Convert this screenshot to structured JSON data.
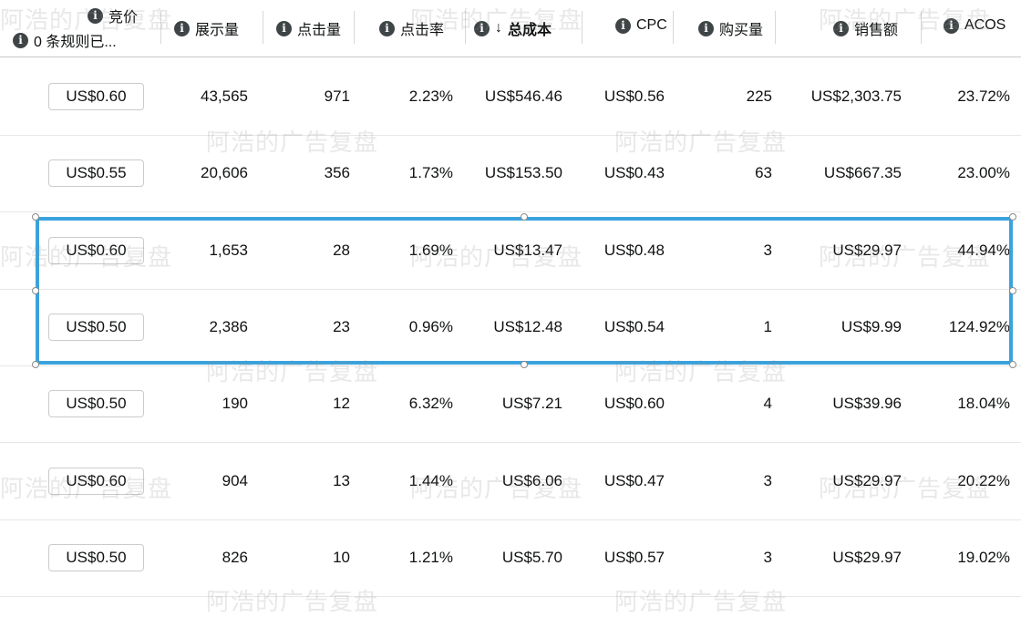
{
  "header": {
    "bid": "竞价",
    "rules": "0 条规则已...",
    "impressions": "展示量",
    "clicks": "点击量",
    "ctr": "点击率",
    "cost_arrow": "↓",
    "cost": "总成本",
    "cpc": "CPC",
    "orders": "购买量",
    "sales": "销售额",
    "acos": "ACOS"
  },
  "rows": [
    {
      "bid": "US$0.60",
      "impressions": "43,565",
      "clicks": "971",
      "ctr": "2.23%",
      "cost": "US$546.46",
      "cpc": "US$0.56",
      "orders": "225",
      "sales": "US$2,303.75",
      "acos": "23.72%"
    },
    {
      "bid": "US$0.55",
      "impressions": "20,606",
      "clicks": "356",
      "ctr": "1.73%",
      "cost": "US$153.50",
      "cpc": "US$0.43",
      "orders": "63",
      "sales": "US$667.35",
      "acos": "23.00%"
    },
    {
      "bid": "US$0.60",
      "impressions": "1,653",
      "clicks": "28",
      "ctr": "1.69%",
      "cost": "US$13.47",
      "cpc": "US$0.48",
      "orders": "3",
      "sales": "US$29.97",
      "acos": "44.94%"
    },
    {
      "bid": "US$0.50",
      "impressions": "2,386",
      "clicks": "23",
      "ctr": "0.96%",
      "cost": "US$12.48",
      "cpc": "US$0.54",
      "orders": "1",
      "sales": "US$9.99",
      "acos": "124.92%"
    },
    {
      "bid": "US$0.50",
      "impressions": "190",
      "clicks": "12",
      "ctr": "6.32%",
      "cost": "US$7.21",
      "cpc": "US$0.60",
      "orders": "4",
      "sales": "US$39.96",
      "acos": "18.04%"
    },
    {
      "bid": "US$0.60",
      "impressions": "904",
      "clicks": "13",
      "ctr": "1.44%",
      "cost": "US$6.06",
      "cpc": "US$0.47",
      "orders": "3",
      "sales": "US$29.97",
      "acos": "20.22%"
    },
    {
      "bid": "US$0.50",
      "impressions": "826",
      "clicks": "10",
      "ctr": "1.21%",
      "cost": "US$5.70",
      "cpc": "US$0.57",
      "orders": "3",
      "sales": "US$29.97",
      "acos": "19.02%"
    }
  ],
  "watermark": "阿浩的广告复盘",
  "colors": {
    "selection": "#3aa3dd",
    "info_icon": "#3f4546"
  },
  "icons": {
    "info": "info-icon",
    "sort": "sort-descending-arrow-icon"
  }
}
